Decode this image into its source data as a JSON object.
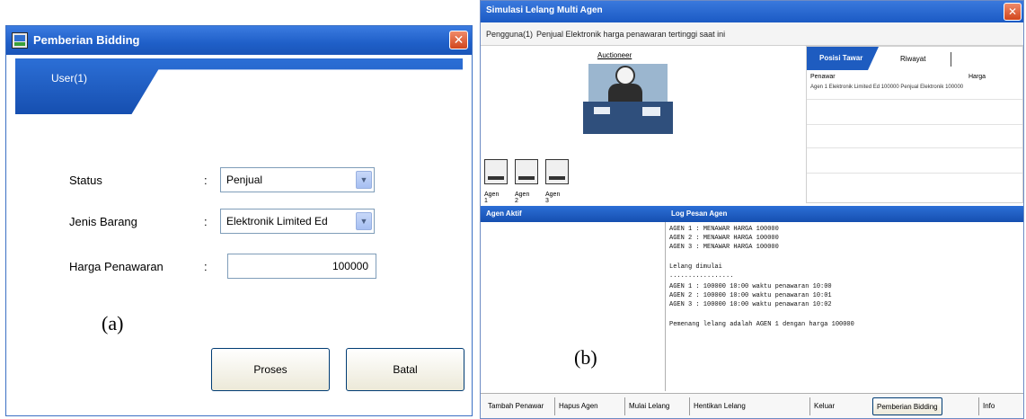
{
  "panel_a": {
    "title": "Pemberian Bidding",
    "close": "✕",
    "user": "User(1)",
    "status_label": "Status",
    "status_value": "Penjual",
    "jenis_label": "Jenis Barang",
    "jenis_value": "Elektronik Limited Ed",
    "harga_label": "Harga Penawaran",
    "harga_value": "100000",
    "colon": ":",
    "dropdown_arrow": "▼",
    "tag": "(a)",
    "proses_button": "Proses",
    "batal_button": "Batal"
  },
  "panel_b": {
    "title": "Simulasi Lelang Multi Agen",
    "close": "✕",
    "info_left": "Pengguna(1)",
    "info_right": "Penjual Elektronik harga penawaran tertinggi saat ini",
    "scene_label": "Auctioneer",
    "pcs": [
      "Agen 1",
      "Agen 2",
      "Agen 3"
    ],
    "pos_tab_active": "Posisi Tawar",
    "pos_tab_2": "Riwayat",
    "pos_headers": [
      "Penawar",
      "Harga"
    ],
    "pos_row": "Agen 1 Elektronik Limited Ed 100000 Penjual Elektronik 100000",
    "left_pane_title": "Agen Aktif",
    "right_pane_title": "Log Pesan Agen",
    "messages": [
      "AGEN 1 : MENAWAR HARGA 100000",
      "AGEN 2 : MENAWAR HARGA 100000",
      "AGEN 3 : MENAWAR HARGA 100000",
      "",
      "Lelang dimulai",
      ".................",
      "AGEN 1 : 100000 10:00 waktu penawaran 10:00",
      "AGEN 2 : 100000 10:00 waktu penawaran 10:01",
      "AGEN 3 : 100000 10:00 waktu penawaran 10:02",
      "",
      "Pemenang lelang adalah AGEN 1 dengan harga 100000"
    ],
    "bottom_buttons": [
      "Tambah Penawar",
      "Hapus Agen",
      "Mulai Lelang",
      "Hentikan Lelang",
      "Keluar",
      "Pemberian Bidding",
      "Info"
    ],
    "tag": "(b)"
  }
}
